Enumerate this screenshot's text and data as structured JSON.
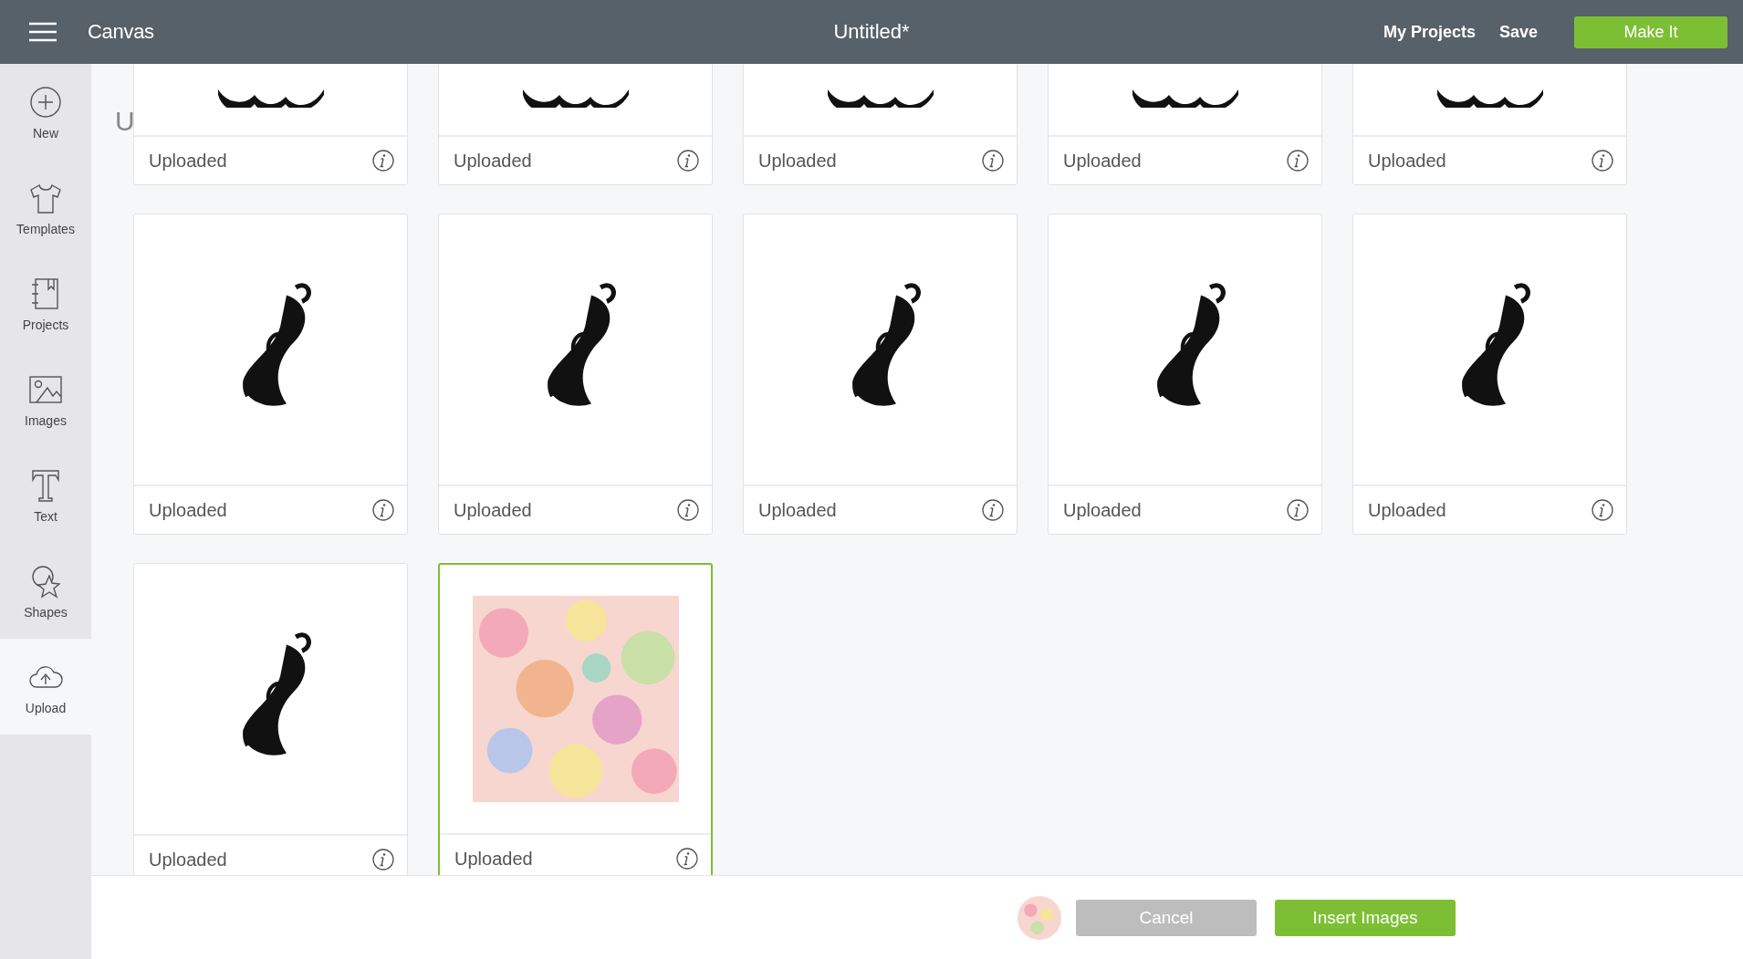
{
  "top_bar": {
    "title": "Canvas",
    "document": "Untitled*",
    "links": [
      {
        "label": "My Projects"
      },
      {
        "label": "Save"
      }
    ],
    "primary_button": "Make It"
  },
  "sidebar": {
    "items": [
      {
        "label": "New",
        "selected": false
      },
      {
        "label": "Templates",
        "selected": false
      },
      {
        "label": "Projects",
        "selected": false
      },
      {
        "label": "Images",
        "selected": false
      },
      {
        "label": "Text",
        "selected": false
      },
      {
        "label": "Shapes",
        "selected": false
      },
      {
        "label": "Upload",
        "selected": true
      }
    ]
  },
  "heading": "U",
  "tiles": [
    {
      "label": "Uploaded",
      "selected": false
    },
    {
      "label": "Uploaded",
      "selected": false
    },
    {
      "label": "Uploaded",
      "selected": false
    },
    {
      "label": "Uploaded",
      "selected": false
    },
    {
      "label": "Uploaded",
      "selected": false
    },
    {
      "label": "Uploaded",
      "selected": false
    },
    {
      "label": "Uploaded",
      "selected": false
    },
    {
      "label": "Uploaded",
      "selected": false
    },
    {
      "label": "Uploaded",
      "selected": false
    },
    {
      "label": "Uploaded",
      "selected": false
    },
    {
      "label": "Uploaded",
      "selected": false
    },
    {
      "label": "Uploaded",
      "selected": true
    }
  ],
  "bottom_bar": {
    "buttons": [
      {
        "label": "Cancel",
        "kind": "secondary"
      },
      {
        "label": "Insert Images",
        "kind": "primary"
      }
    ]
  }
}
